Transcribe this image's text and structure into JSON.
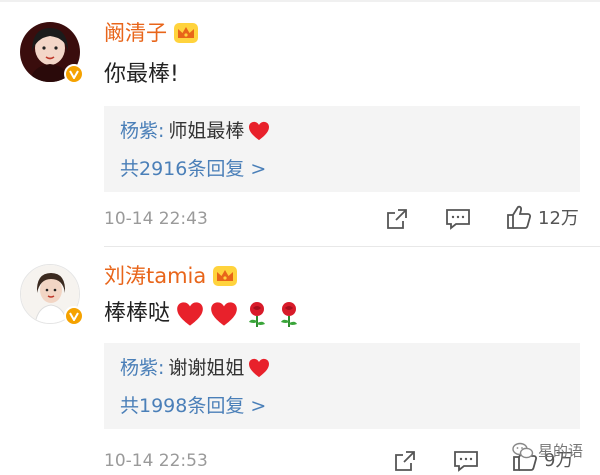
{
  "comments": [
    {
      "username": "阚清子",
      "text": "你最棒!",
      "reply": {
        "user": "杨紫:",
        "text": "师姐最棒"
      },
      "reply_count_label": "共2916条回复 >",
      "timestamp": "10-14 22:43",
      "likes": "12万"
    },
    {
      "username": "刘涛tamia",
      "text": "棒棒哒",
      "reply": {
        "user": "杨紫:",
        "text": "谢谢姐姐"
      },
      "reply_count_label": "共1998条回复 >",
      "timestamp": "10-14 22:53",
      "likes": "9万"
    }
  ],
  "watermark": {
    "text": "星的语"
  },
  "colors": {
    "username": "#e8651a",
    "link": "#4a7fb8",
    "heart": "#e8212b",
    "badge": "#f5a200"
  },
  "icons": [
    "crown-icon",
    "verified-badge-icon",
    "share-icon",
    "comment-icon",
    "like-icon",
    "heart-emoji-icon",
    "rose-emoji-icon",
    "wechat-icon"
  ]
}
